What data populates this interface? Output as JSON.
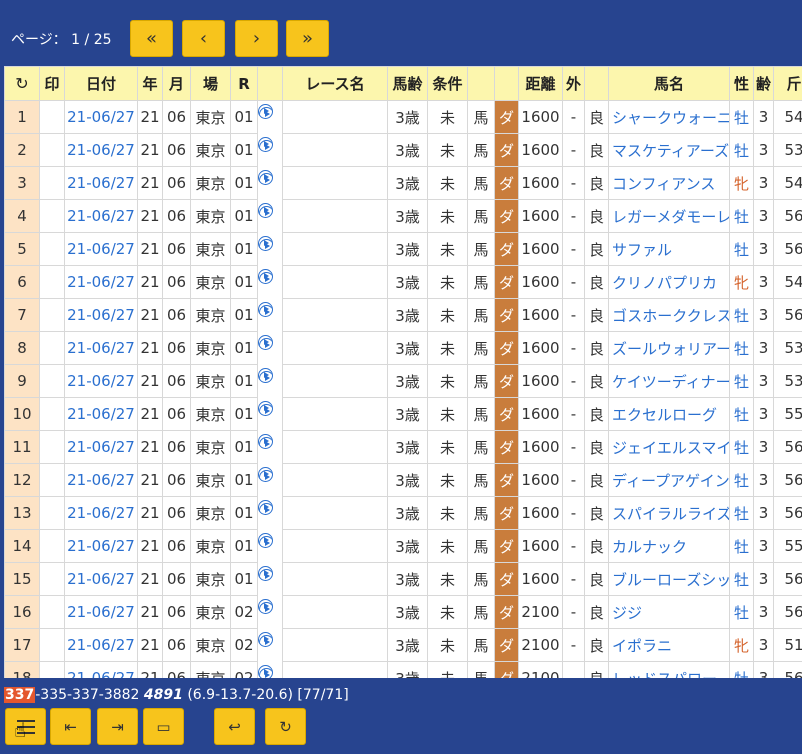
{
  "pager": {
    "label": "ページ： 1 / 25",
    "first": "«",
    "prev": "‹",
    "next": "›",
    "last": "»"
  },
  "columns": [
    "↻",
    "印",
    "日付",
    "年",
    "月",
    "場",
    "R",
    "",
    "レース名",
    "馬齢",
    "条件",
    "",
    "",
    "距離",
    "外",
    "",
    "馬名",
    "性",
    "齢",
    "斤"
  ],
  "rows": [
    {
      "i": "1",
      "date": "21-06/27",
      "y": "21",
      "m": "06",
      "place": "東京",
      "r": "01",
      "age": "3歳",
      "cond": "未",
      "type": "馬",
      "track": "ダ",
      "dist": "1600",
      "out": "-",
      "going": "良",
      "horse": "シャークウォーニン",
      "sex": "牡",
      "hage": "3",
      "kin": "54"
    },
    {
      "i": "2",
      "date": "21-06/27",
      "y": "21",
      "m": "06",
      "place": "東京",
      "r": "01",
      "age": "3歳",
      "cond": "未",
      "type": "馬",
      "track": "ダ",
      "dist": "1600",
      "out": "-",
      "going": "良",
      "horse": "マスケティアーズ",
      "sex": "牡",
      "hage": "3",
      "kin": "53"
    },
    {
      "i": "3",
      "date": "21-06/27",
      "y": "21",
      "m": "06",
      "place": "東京",
      "r": "01",
      "age": "3歳",
      "cond": "未",
      "type": "馬",
      "track": "ダ",
      "dist": "1600",
      "out": "-",
      "going": "良",
      "horse": "コンフィアンス",
      "sex": "牝",
      "hage": "3",
      "kin": "54"
    },
    {
      "i": "4",
      "date": "21-06/27",
      "y": "21",
      "m": "06",
      "place": "東京",
      "r": "01",
      "age": "3歳",
      "cond": "未",
      "type": "馬",
      "track": "ダ",
      "dist": "1600",
      "out": "-",
      "going": "良",
      "horse": "レガーメダモーレ",
      "sex": "牡",
      "hage": "3",
      "kin": "56"
    },
    {
      "i": "5",
      "date": "21-06/27",
      "y": "21",
      "m": "06",
      "place": "東京",
      "r": "01",
      "age": "3歳",
      "cond": "未",
      "type": "馬",
      "track": "ダ",
      "dist": "1600",
      "out": "-",
      "going": "良",
      "horse": "サファル",
      "sex": "牡",
      "hage": "3",
      "kin": "56"
    },
    {
      "i": "6",
      "date": "21-06/27",
      "y": "21",
      "m": "06",
      "place": "東京",
      "r": "01",
      "age": "3歳",
      "cond": "未",
      "type": "馬",
      "track": "ダ",
      "dist": "1600",
      "out": "-",
      "going": "良",
      "horse": "クリノパプリカ",
      "sex": "牝",
      "hage": "3",
      "kin": "54"
    },
    {
      "i": "7",
      "date": "21-06/27",
      "y": "21",
      "m": "06",
      "place": "東京",
      "r": "01",
      "age": "3歳",
      "cond": "未",
      "type": "馬",
      "track": "ダ",
      "dist": "1600",
      "out": "-",
      "going": "良",
      "horse": "ゴスホーククレスト",
      "sex": "牡",
      "hage": "3",
      "kin": "56"
    },
    {
      "i": "8",
      "date": "21-06/27",
      "y": "21",
      "m": "06",
      "place": "東京",
      "r": "01",
      "age": "3歳",
      "cond": "未",
      "type": "馬",
      "track": "ダ",
      "dist": "1600",
      "out": "-",
      "going": "良",
      "horse": "ズールウォリアー",
      "sex": "牡",
      "hage": "3",
      "kin": "53"
    },
    {
      "i": "9",
      "date": "21-06/27",
      "y": "21",
      "m": "06",
      "place": "東京",
      "r": "01",
      "age": "3歳",
      "cond": "未",
      "type": "馬",
      "track": "ダ",
      "dist": "1600",
      "out": "-",
      "going": "良",
      "horse": "ケイツーディナール",
      "sex": "牡",
      "hage": "3",
      "kin": "53"
    },
    {
      "i": "10",
      "date": "21-06/27",
      "y": "21",
      "m": "06",
      "place": "東京",
      "r": "01",
      "age": "3歳",
      "cond": "未",
      "type": "馬",
      "track": "ダ",
      "dist": "1600",
      "out": "-",
      "going": "良",
      "horse": "エクセルローグ",
      "sex": "牡",
      "hage": "3",
      "kin": "55"
    },
    {
      "i": "11",
      "date": "21-06/27",
      "y": "21",
      "m": "06",
      "place": "東京",
      "r": "01",
      "age": "3歳",
      "cond": "未",
      "type": "馬",
      "track": "ダ",
      "dist": "1600",
      "out": "-",
      "going": "良",
      "horse": "ジェイエルスマイル",
      "sex": "牡",
      "hage": "3",
      "kin": "56"
    },
    {
      "i": "12",
      "date": "21-06/27",
      "y": "21",
      "m": "06",
      "place": "東京",
      "r": "01",
      "age": "3歳",
      "cond": "未",
      "type": "馬",
      "track": "ダ",
      "dist": "1600",
      "out": "-",
      "going": "良",
      "horse": "ディープアゲイン",
      "sex": "牡",
      "hage": "3",
      "kin": "56"
    },
    {
      "i": "13",
      "date": "21-06/27",
      "y": "21",
      "m": "06",
      "place": "東京",
      "r": "01",
      "age": "3歳",
      "cond": "未",
      "type": "馬",
      "track": "ダ",
      "dist": "1600",
      "out": "-",
      "going": "良",
      "horse": "スパイラルライズ",
      "sex": "牡",
      "hage": "3",
      "kin": "56"
    },
    {
      "i": "14",
      "date": "21-06/27",
      "y": "21",
      "m": "06",
      "place": "東京",
      "r": "01",
      "age": "3歳",
      "cond": "未",
      "type": "馬",
      "track": "ダ",
      "dist": "1600",
      "out": "-",
      "going": "良",
      "horse": "カルナック",
      "sex": "牡",
      "hage": "3",
      "kin": "55"
    },
    {
      "i": "15",
      "date": "21-06/27",
      "y": "21",
      "m": "06",
      "place": "東京",
      "r": "01",
      "age": "3歳",
      "cond": "未",
      "type": "馬",
      "track": "ダ",
      "dist": "1600",
      "out": "-",
      "going": "良",
      "horse": "ブルーローズシップ",
      "sex": "牡",
      "hage": "3",
      "kin": "56"
    },
    {
      "i": "16",
      "date": "21-06/27",
      "y": "21",
      "m": "06",
      "place": "東京",
      "r": "02",
      "age": "3歳",
      "cond": "未",
      "type": "馬",
      "track": "ダ",
      "dist": "2100",
      "out": "-",
      "going": "良",
      "horse": "ジジ",
      "sex": "牡",
      "hage": "3",
      "kin": "56"
    },
    {
      "i": "17",
      "date": "21-06/27",
      "y": "21",
      "m": "06",
      "place": "東京",
      "r": "02",
      "age": "3歳",
      "cond": "未",
      "type": "馬",
      "track": "ダ",
      "dist": "2100",
      "out": "-",
      "going": "良",
      "horse": "イポラニ",
      "sex": "牝",
      "hage": "3",
      "kin": "51"
    },
    {
      "i": "18",
      "date": "21-06/27",
      "y": "21",
      "m": "06",
      "place": "東京",
      "r": "02",
      "age": "3歳",
      "cond": "未",
      "type": "馬",
      "track": "ダ",
      "dist": "2100",
      "out": "-",
      "going": "良",
      "horse": "レッドスパロー",
      "sex": "牡",
      "hage": "3",
      "kin": "56"
    }
  ],
  "footer": {
    "status_hl": "337",
    "status_rest": "-335-337-3882 ",
    "status_num": "4891",
    "status_tail": " (6.9-13.7-20.6) [77/71]",
    "btn_prev_page": "⇤",
    "btn_next_page": "⇥",
    "btn_window": "▭",
    "btn_back": "↩",
    "btn_reload": "↻"
  },
  "colors": {
    "background": "#27448f",
    "button": "#f7c41c",
    "header": "#fcf6ad",
    "index": "#fde3c5",
    "dirt": "#c97d3c",
    "link": "#2a6fcf",
    "female": "#d4622a",
    "highlight": "#e4572e"
  }
}
